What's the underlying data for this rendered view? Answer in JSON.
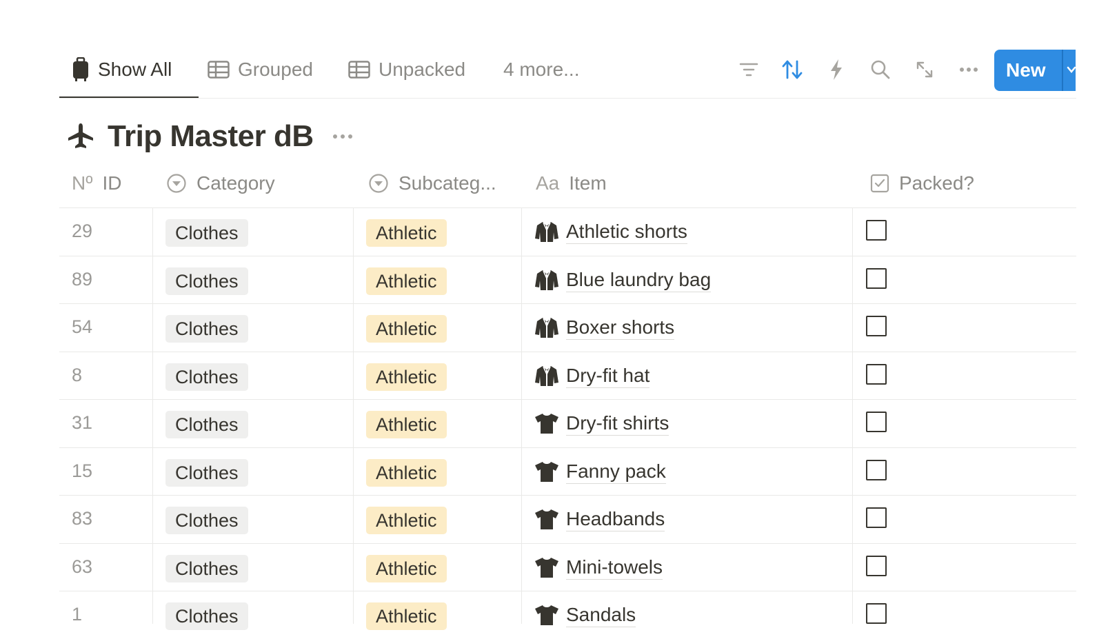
{
  "tabs": [
    {
      "label": "Show All",
      "icon": "luggage-icon",
      "active": true
    },
    {
      "label": "Grouped",
      "icon": "table-icon",
      "active": false
    },
    {
      "label": "Unpacked",
      "icon": "table-icon",
      "active": false
    },
    {
      "label": "4 more...",
      "icon": "",
      "active": false
    }
  ],
  "toolbar": {
    "tools": [
      "filter-icon",
      "sort-icon",
      "automation-bolt-icon",
      "search-icon",
      "expand-icon",
      "more-icon"
    ],
    "new_label": "New"
  },
  "database": {
    "title": "Trip Master dB",
    "icon": "airplane-icon"
  },
  "columns": {
    "id": {
      "icon_text": "Nº",
      "label": "ID"
    },
    "category": {
      "label": "Category",
      "icon": "select-icon"
    },
    "subcategory": {
      "label": "Subcateg...",
      "icon": "select-icon"
    },
    "item": {
      "icon_text": "Aa",
      "label": "Item"
    },
    "packed": {
      "label": "Packed?",
      "icon": "checkbox-icon"
    }
  },
  "rows": [
    {
      "id": "29",
      "category": "Clothes",
      "subcategory": "Athletic",
      "item": "Athletic shorts",
      "icon": "jacket-icon",
      "packed": false
    },
    {
      "id": "89",
      "category": "Clothes",
      "subcategory": "Athletic",
      "item": "Blue laundry bag",
      "icon": "jacket-icon",
      "packed": false
    },
    {
      "id": "54",
      "category": "Clothes",
      "subcategory": "Athletic",
      "item": "Boxer shorts",
      "icon": "jacket-icon",
      "packed": false
    },
    {
      "id": "8",
      "category": "Clothes",
      "subcategory": "Athletic",
      "item": "Dry-fit hat",
      "icon": "jacket-icon",
      "packed": false
    },
    {
      "id": "31",
      "category": "Clothes",
      "subcategory": "Athletic",
      "item": "Dry-fit shirts",
      "icon": "tshirt-icon",
      "packed": false
    },
    {
      "id": "15",
      "category": "Clothes",
      "subcategory": "Athletic",
      "item": "Fanny pack",
      "icon": "tshirt-icon",
      "packed": false
    },
    {
      "id": "83",
      "category": "Clothes",
      "subcategory": "Athletic",
      "item": "Headbands",
      "icon": "tshirt-icon",
      "packed": false
    },
    {
      "id": "63",
      "category": "Clothes",
      "subcategory": "Athletic",
      "item": "Mini-towels",
      "icon": "tshirt-icon",
      "packed": false
    },
    {
      "id": "1",
      "category": "Clothes",
      "subcategory": "Athletic",
      "item": "Sandals",
      "icon": "tshirt-icon",
      "packed": false
    }
  ],
  "colors": {
    "accent": "#2f8ce2",
    "category_tag_bg": "#efefee",
    "subcategory_tag_bg": "#fcecc6",
    "text": "#37352f",
    "muted": "#8b8a86"
  }
}
